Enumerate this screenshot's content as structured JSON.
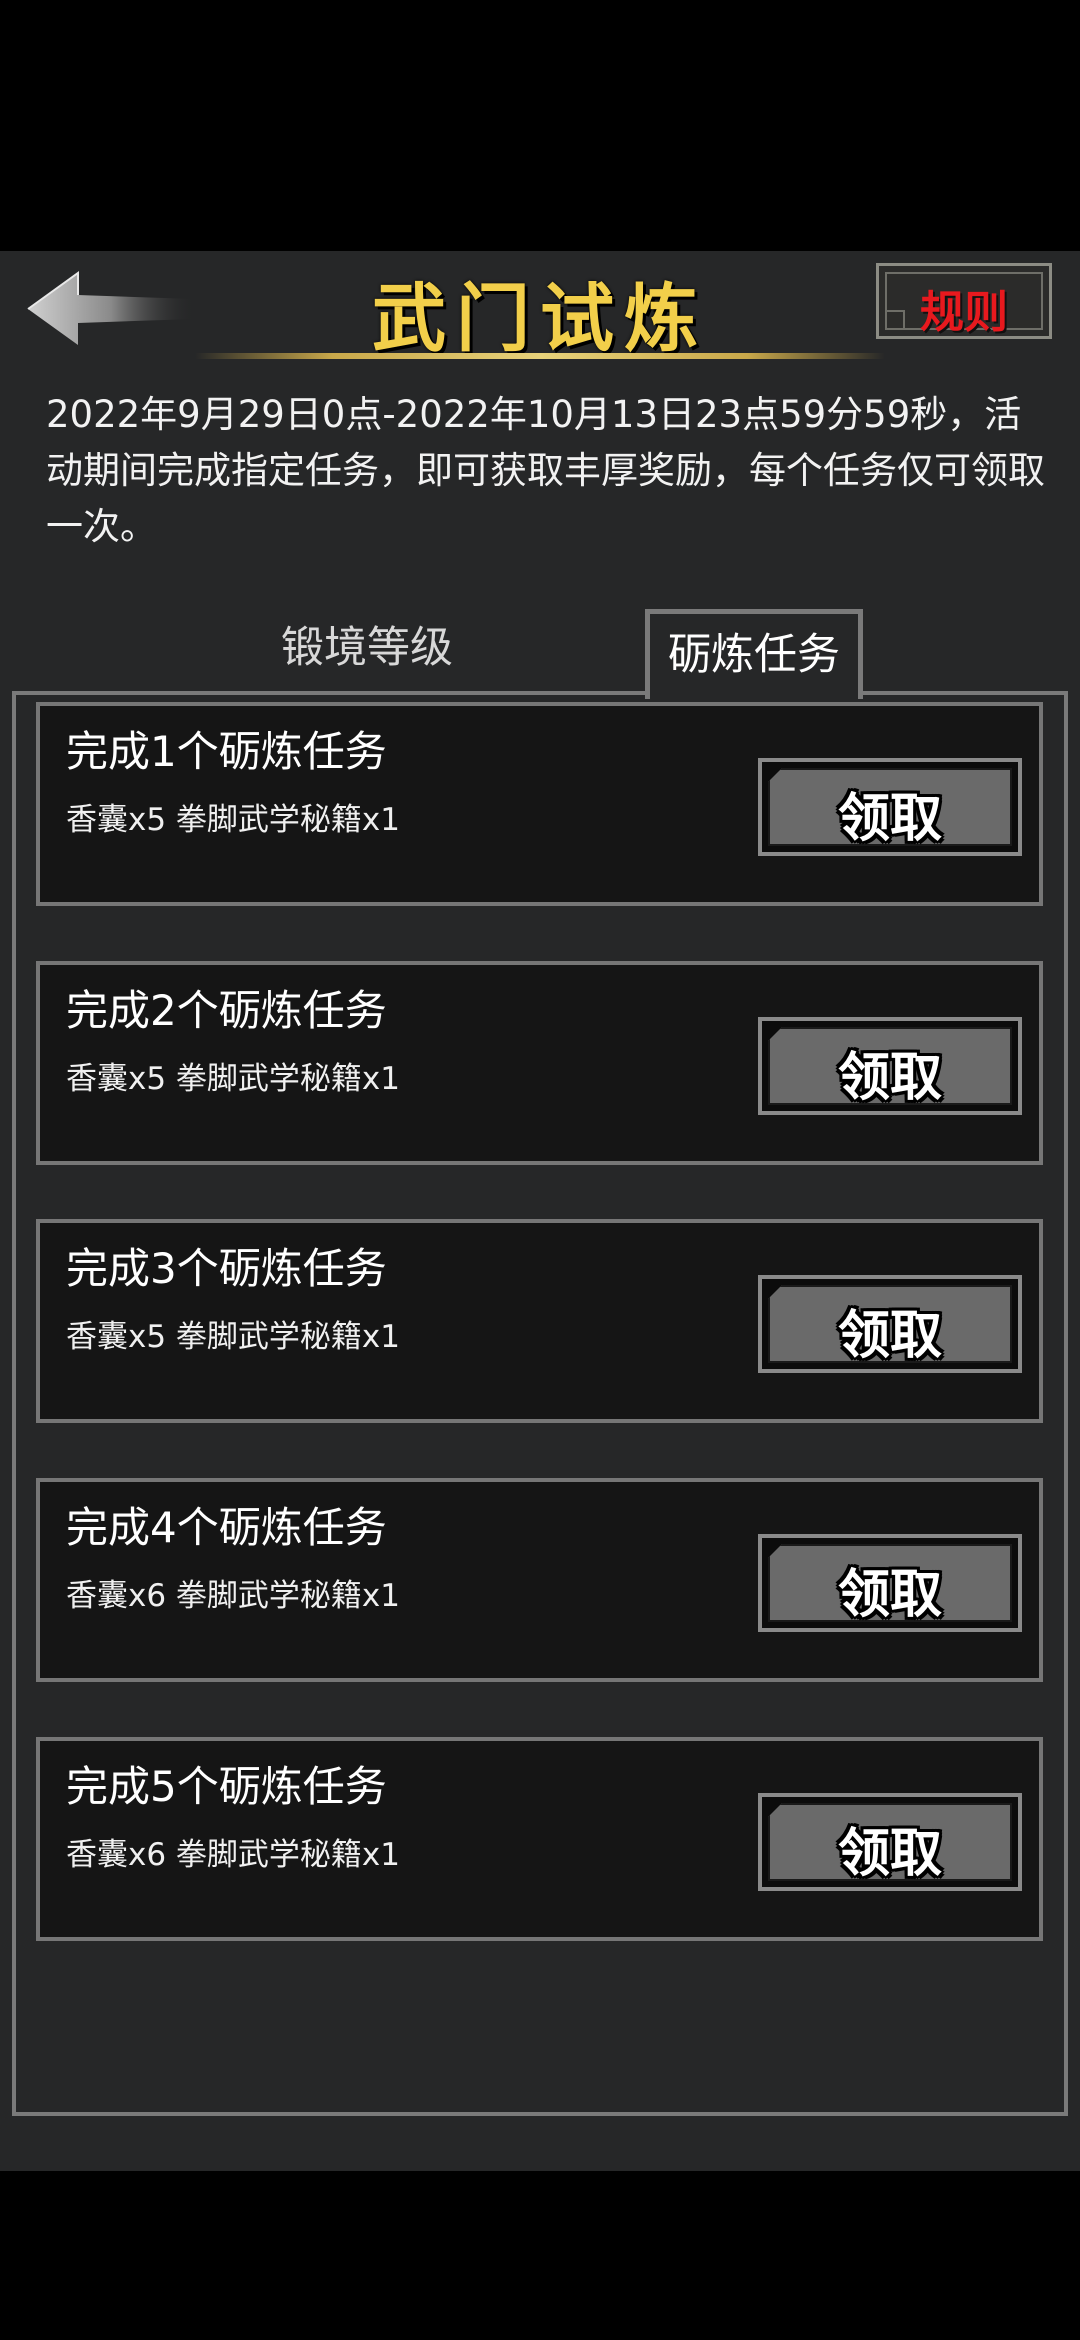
{
  "header": {
    "title": "武门试炼",
    "rules_label": "规则"
  },
  "description": "2022年9月29日0点-2022年10月13日23点59分59秒，活动期间完成指定任务，即可获取丰厚奖励，每个任务仅可领取一次。",
  "tabs": [
    {
      "label": "锻境等级",
      "active": false
    },
    {
      "label": "砺炼任务",
      "active": true
    }
  ],
  "tasks": [
    {
      "title": "完成1个砺炼任务",
      "reward": "香囊x5 拳脚武学秘籍x1",
      "button": "领取"
    },
    {
      "title": "完成2个砺炼任务",
      "reward": "香囊x5 拳脚武学秘籍x1",
      "button": "领取"
    },
    {
      "title": "完成3个砺炼任务",
      "reward": "香囊x5 拳脚武学秘籍x1",
      "button": "领取"
    },
    {
      "title": "完成4个砺炼任务",
      "reward": "香囊x6 拳脚武学秘籍x1",
      "button": "领取"
    },
    {
      "title": "完成5个砺炼任务",
      "reward": "香囊x6 拳脚武学秘籍x1",
      "button": "领取"
    }
  ],
  "colors": {
    "title_gold": "#f2cf4a",
    "rules_red": "#e8191e",
    "background": "#262728",
    "card": "#151515"
  }
}
